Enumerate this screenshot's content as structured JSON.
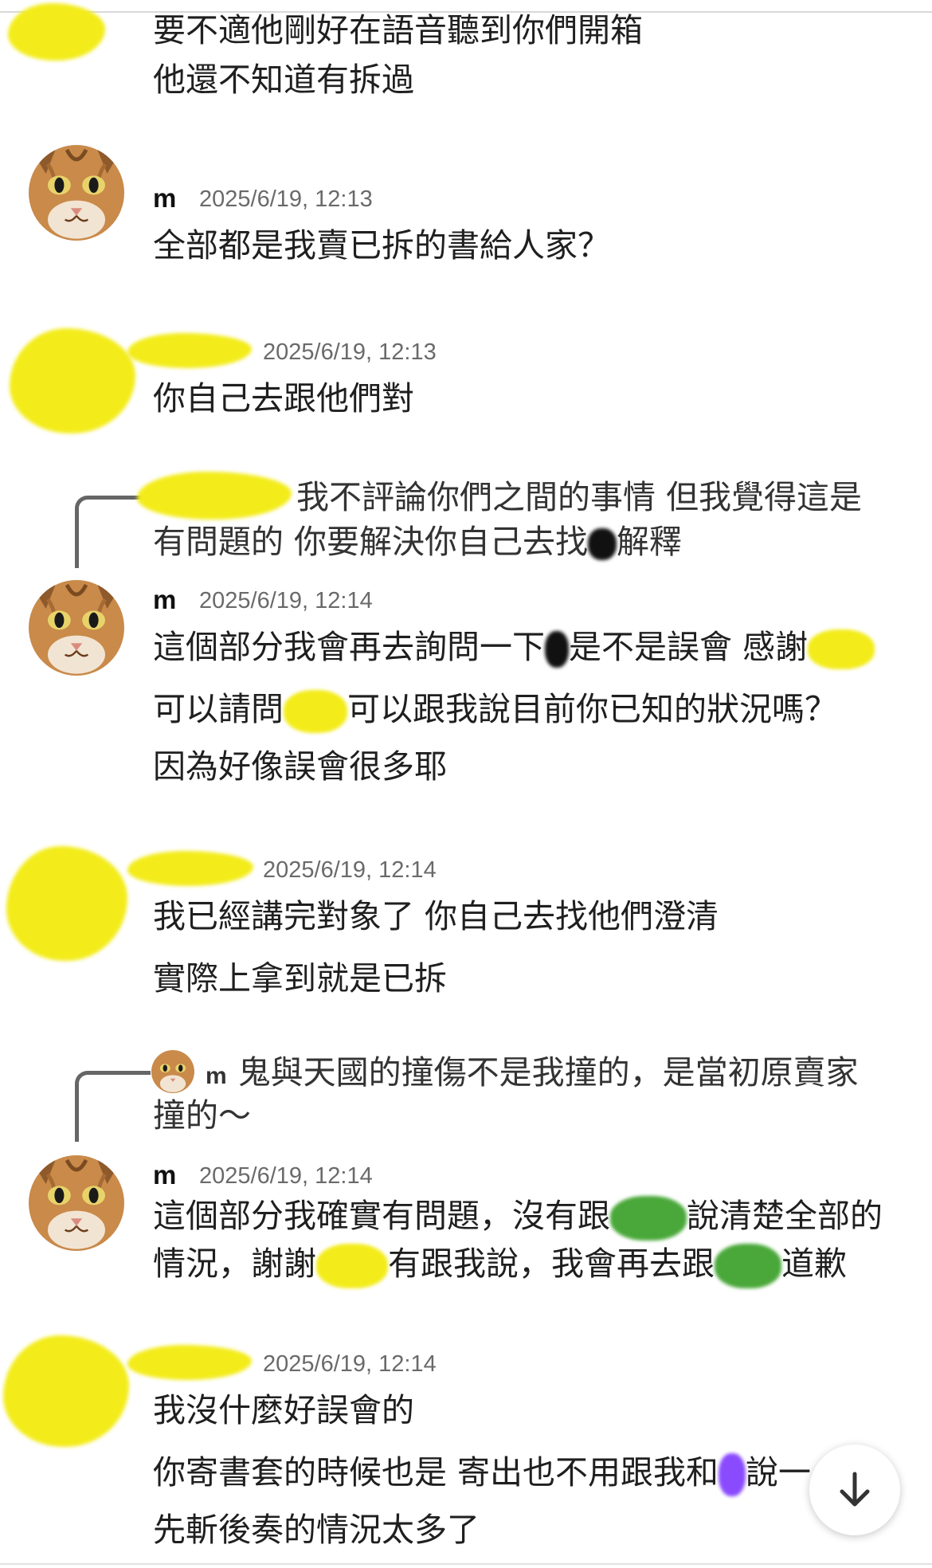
{
  "messages": [
    {
      "lines": [
        "要不適他剛好在語音聽到你們開箱",
        "他還不知道有拆過"
      ]
    },
    {
      "author": "m",
      "time": "2025/6/19, 12:13",
      "lines": [
        "全部都是我賣已拆的書給人家？"
      ]
    },
    {
      "time": "2025/6/19, 12:13",
      "lines": [
        "你自己去跟他們對"
      ]
    },
    {
      "reply_preview": {
        "text_a": "我不評論你們之間的事情  但我覺得這是",
        "text_b_1": "有問題的  你要解決你自己去找",
        "text_b_2": "解釋"
      },
      "author": "m",
      "time": "2025/6/19, 12:14",
      "lines_parts": {
        "l1a": "這個部分我會再去詢問一下",
        "l1b": "是不是誤會  感謝",
        "l2a": "可以請問",
        "l2b": "可以跟我說目前你已知的狀況嗎？",
        "l3": "因為好像誤會很多耶"
      }
    },
    {
      "time": "2025/6/19, 12:14",
      "lines": [
        "我已經講完對象了  你自己去找他們澄清",
        "實際上拿到就是已拆"
      ]
    },
    {
      "reply_preview": {
        "author": "m",
        "text_a": "鬼與天國的撞傷不是我撞的，是當初原賣家",
        "text_b": "撞的～"
      },
      "author": "m",
      "time": "2025/6/19, 12:14",
      "lines_parts": {
        "l1a": "這個部分我確實有問題，沒有跟",
        "l1b": "說清楚全部的",
        "l2a": "情況，謝謝",
        "l2b": "有跟我說，我會再去跟",
        "l2c": "道歉"
      }
    },
    {
      "time": "2025/6/19, 12:14",
      "lines_parts": {
        "l1": "我沒什麼好誤會的",
        "l2a": "你寄書套的時候也是  寄出也不用跟我和",
        "l2b": "說一",
        "l3": "先斬後奏的情況太多了"
      }
    }
  ],
  "colors": {
    "redact_yellow": "#f3ec1a",
    "redact_green": "#4aa83a",
    "redact_purple": "#8a4bff",
    "timestamp": "#6a6a6a"
  },
  "icons": {
    "avatar": "orange-cat-face-icon",
    "scroll_button": "arrow-down-icon"
  }
}
